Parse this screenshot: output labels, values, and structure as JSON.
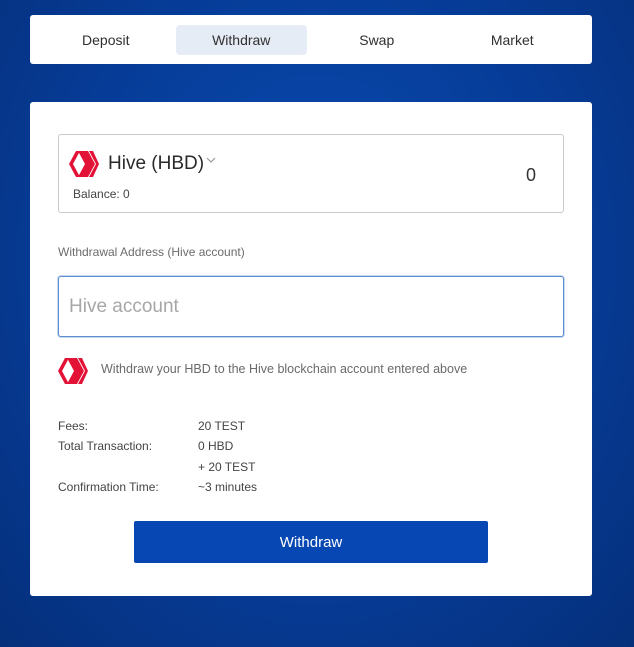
{
  "tabs": [
    {
      "label": "Deposit"
    },
    {
      "label": "Withdraw"
    },
    {
      "label": "Swap"
    },
    {
      "label": "Market"
    }
  ],
  "asset": {
    "name": "Hive (HBD)",
    "balance": "Balance: 0",
    "amount": "0",
    "logo_color": "#e31337"
  },
  "address": {
    "label": "Withdrawal Address (Hive account)",
    "placeholder": "Hive account",
    "value": ""
  },
  "info": {
    "text": "Withdraw your HBD to the Hive blockchain account entered above"
  },
  "details": {
    "fees_label": "Fees:",
    "fees_value": "20 TEST",
    "total_label": "Total Transaction:",
    "total_value_1": "0 HBD",
    "total_value_2": "+ 20 TEST",
    "confirm_label": "Confirmation Time:",
    "confirm_value": "~3 minutes"
  },
  "action": {
    "withdraw_label": "Withdraw"
  },
  "colors": {
    "accent": "#0647b3",
    "background": "#063c98"
  }
}
